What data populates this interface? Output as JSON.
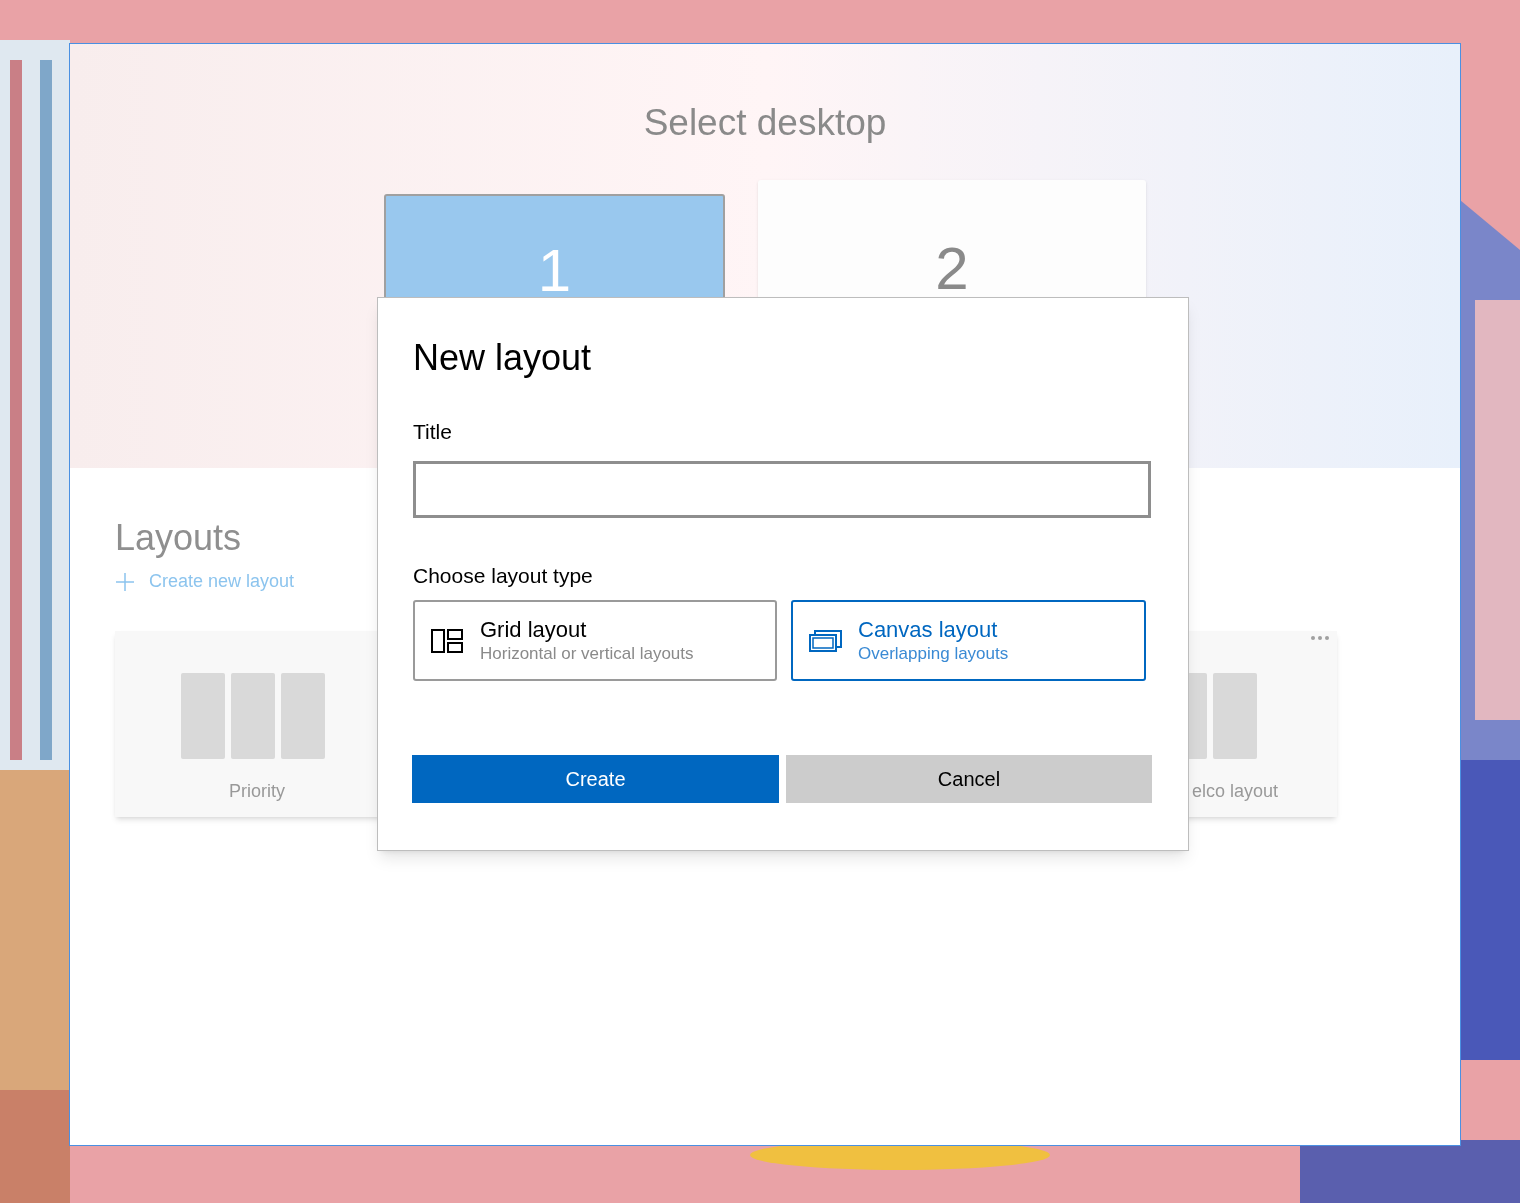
{
  "app": {
    "title": "Select desktop",
    "desktops": [
      {
        "label": "1",
        "selected": true
      },
      {
        "label": "2",
        "selected": false
      }
    ],
    "layouts_heading": "Layouts",
    "create_link": "Create new layout",
    "layout_cards": [
      {
        "label": "Priority"
      },
      {
        "label": "elco layout",
        "more_menu": true
      }
    ]
  },
  "dialog": {
    "title": "New layout",
    "title_label": "Title",
    "type_label": "Choose layout type",
    "options": [
      {
        "kind": "grid",
        "title": "Grid layout",
        "subtitle": "Horizontal or vertical layouts",
        "selected": false
      },
      {
        "kind": "canvas",
        "title": "Canvas layout",
        "subtitle": "Overlapping layouts",
        "selected": true
      }
    ],
    "buttons": [
      {
        "label": "Create",
        "primary": true
      },
      {
        "label": "Cancel",
        "primary": false
      }
    ]
  }
}
